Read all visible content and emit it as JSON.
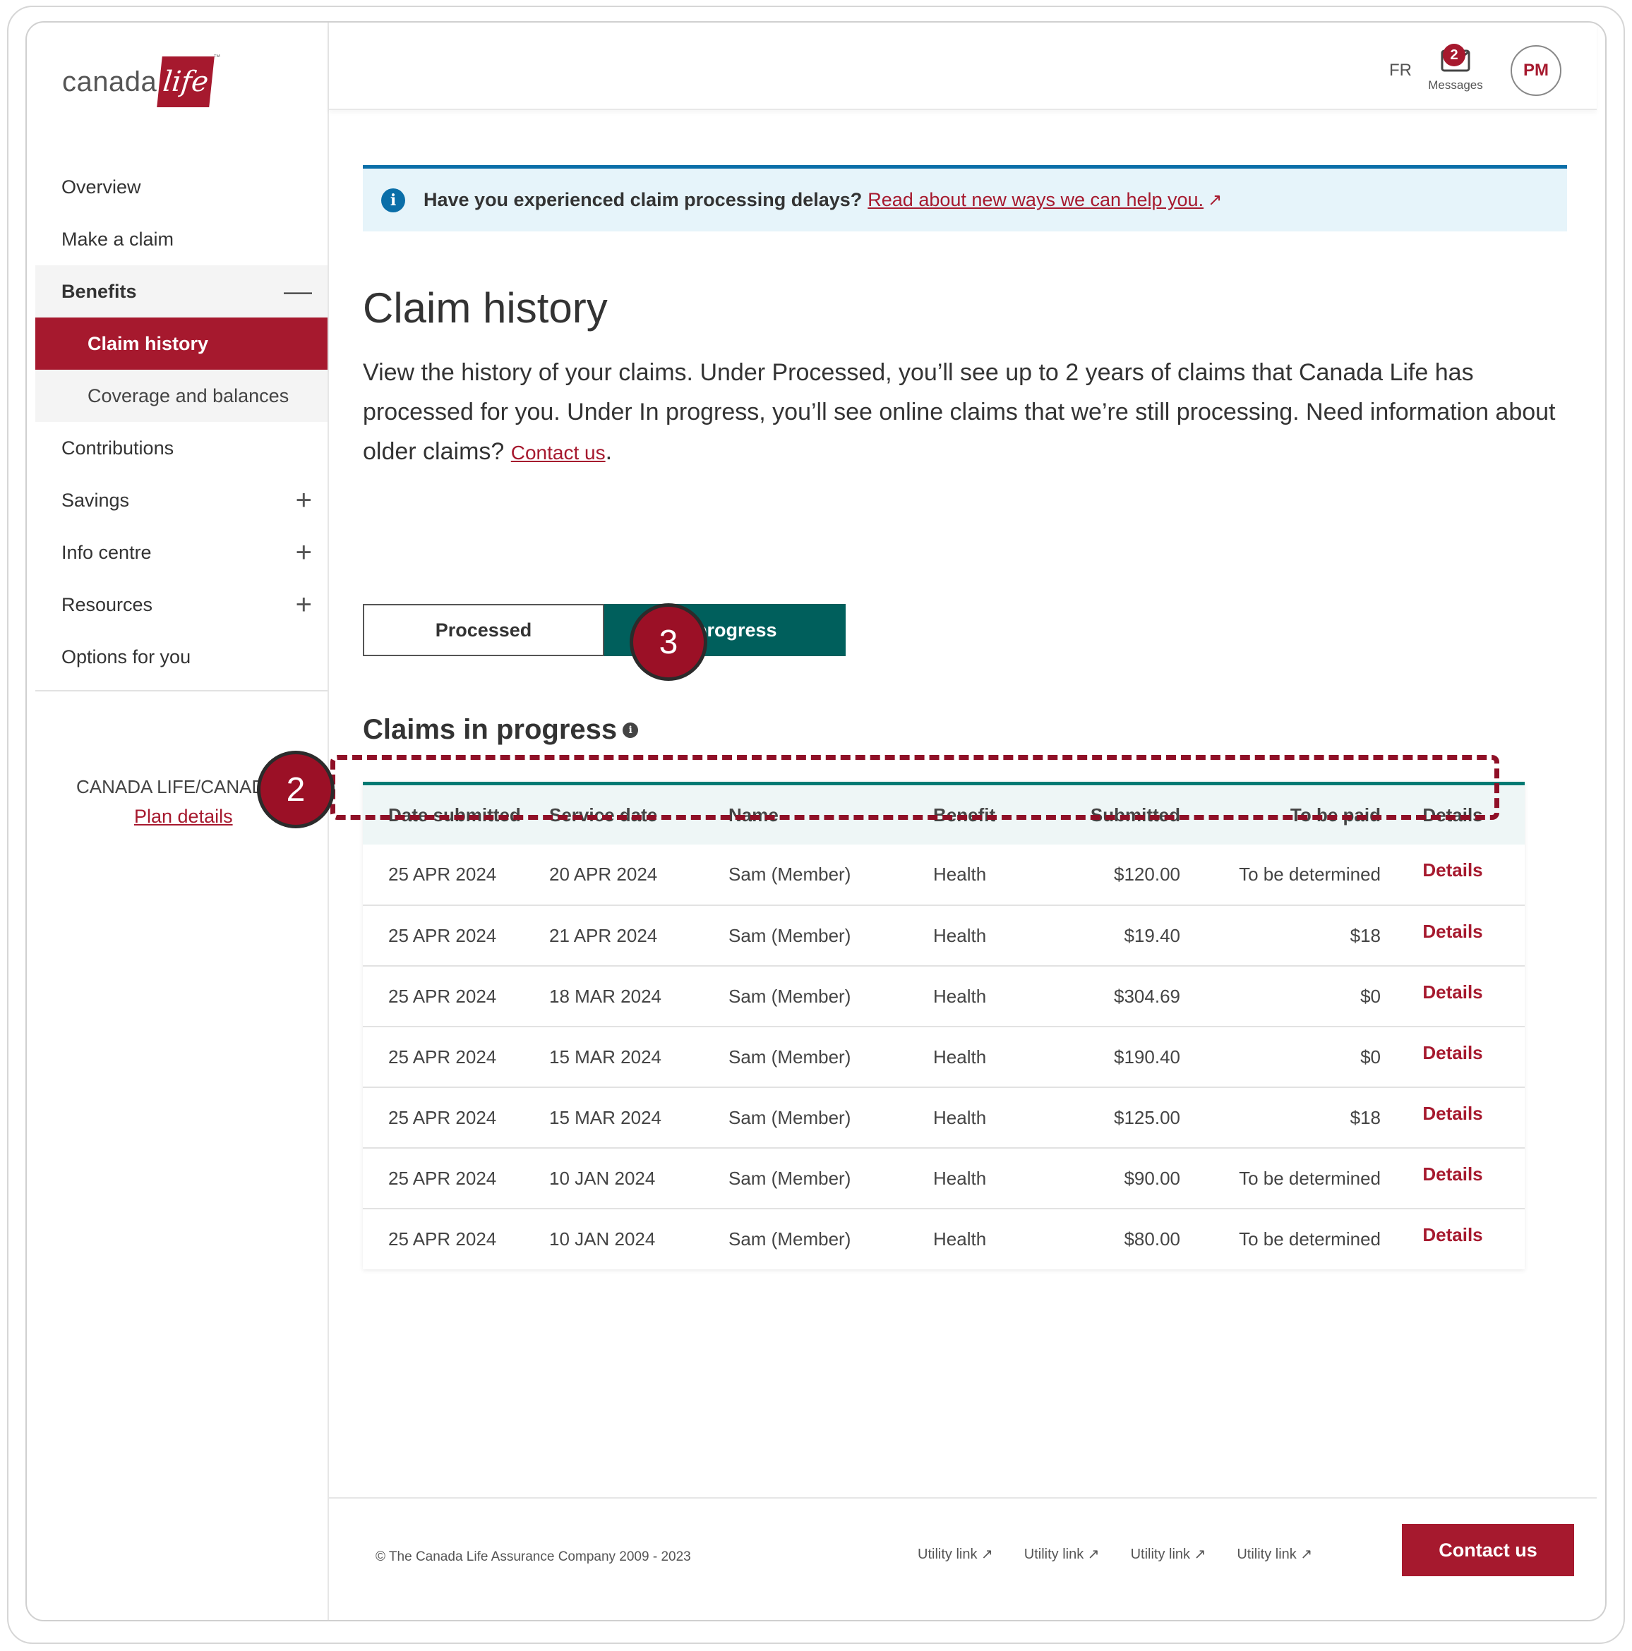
{
  "brand": {
    "word": "canada",
    "box": "life",
    "tm": "™",
    "color": "#a6192e"
  },
  "header": {
    "lang": "FR",
    "messages_label": "Messages",
    "messages_count": "2",
    "avatar_initials": "PM"
  },
  "sidebar": {
    "items": [
      {
        "label": "Overview"
      },
      {
        "label": "Make a claim"
      },
      {
        "label": "Benefits",
        "toggle": "—"
      },
      {
        "label": "Claim history"
      },
      {
        "label": "Coverage and balances"
      },
      {
        "label": "Contributions"
      },
      {
        "label": "Savings",
        "toggle": "+"
      },
      {
        "label": "Info centre",
        "toggle": "+"
      },
      {
        "label": "Resources",
        "toggle": "+"
      },
      {
        "label": "Options for you"
      }
    ],
    "plan_org": "CANADA LIFE/CANADA",
    "plan_link": "Plan details"
  },
  "alert": {
    "text": "Have you experienced claim processing delays?",
    "link": "Read about new ways we can help you.",
    "link_arrow": "↗"
  },
  "page": {
    "title": "Claim history",
    "intro": "View the history of your claims. Under Processed, you’ll see up to 2 years of claims that Canada Life has processed for you. Under In progress, you’ll see online claims that we’re still processing. Need information about older claims?",
    "intro_link": "Contact us",
    "intro_end": "."
  },
  "tabs": {
    "processed": "Processed",
    "in_progress": "In progress"
  },
  "section": {
    "title": "Claims in progress"
  },
  "table": {
    "headers": [
      "Date submitted",
      "Service date",
      "Name",
      "Benefit",
      "Submitted",
      "To be paid",
      "Details"
    ],
    "rows": [
      [
        "25 APR 2024",
        "20 APR 2024",
        "Sam (Member)",
        "Health",
        "$120.00",
        "To be determined",
        "Details"
      ],
      [
        "25 APR 2024",
        "21 APR 2024",
        "Sam (Member)",
        "Health",
        "$19.40",
        "$18",
        "Details"
      ],
      [
        "25 APR 2024",
        "18 MAR 2024",
        "Sam (Member)",
        "Health",
        "$304.69",
        "$0",
        "Details"
      ],
      [
        "25 APR 2024",
        "15 MAR 2024",
        "Sam (Member)",
        "Health",
        "$190.40",
        "$0",
        "Details"
      ],
      [
        "25 APR 2024",
        "15 MAR 2024",
        "Sam (Member)",
        "Health",
        "$125.00",
        "$18",
        "Details"
      ],
      [
        "25 APR 2024",
        "10 JAN 2024",
        "Sam (Member)",
        "Health",
        "$90.00",
        "To be determined",
        "Details"
      ],
      [
        "25 APR 2024",
        "10 JAN 2024",
        "Sam (Member)",
        "Health",
        "$80.00",
        "To be determined",
        "Details"
      ]
    ]
  },
  "callouts": {
    "two": "2",
    "three": "3"
  },
  "footer": {
    "copyright": "© The Canada Life Assurance Company 2009 - 2023",
    "utility_links": [
      "Utility link ↗",
      "Utility link ↗",
      "Utility link ↗",
      "Utility link ↗"
    ],
    "contact": "Contact us"
  }
}
